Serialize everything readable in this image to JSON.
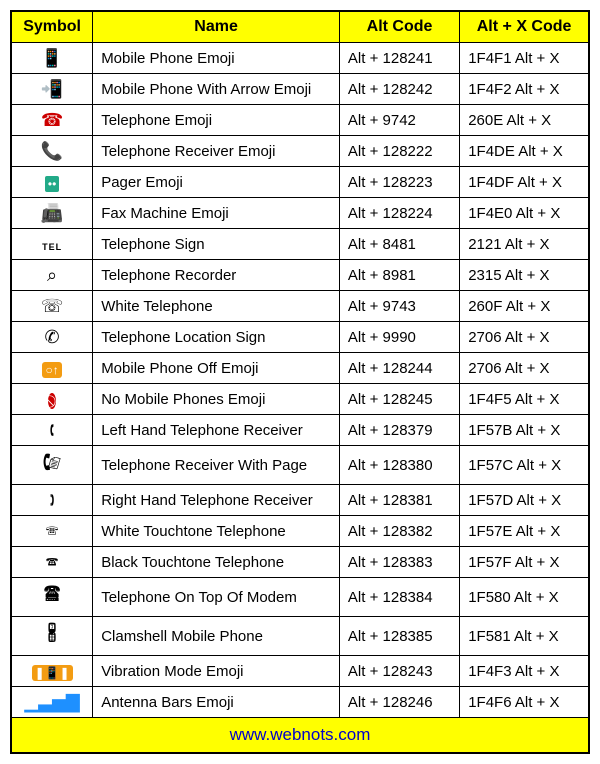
{
  "headers": {
    "symbol": "Symbol",
    "name": "Name",
    "altcode": "Alt Code",
    "altx": "Alt + X Code"
  },
  "rows": [
    {
      "symbol": "📱",
      "name": "Mobile Phone Emoji",
      "altcode": "Alt + 128241",
      "altx": "1F4F1 Alt + X"
    },
    {
      "symbol": "📲",
      "name": "Mobile Phone With Arrow Emoji",
      "altcode": "Alt + 128242",
      "altx": "1F4F2 Alt + X"
    },
    {
      "symbol": "☎",
      "name": "Telephone Emoji",
      "altcode": "Alt + 9742",
      "altx": "260E Alt + X"
    },
    {
      "symbol": "📞",
      "name": "Telephone Receiver Emoji",
      "altcode": "Alt + 128222",
      "altx": "1F4DE Alt + X"
    },
    {
      "symbol": "📟",
      "name": "Pager Emoji",
      "altcode": "Alt + 128223",
      "altx": "1F4DF Alt + X"
    },
    {
      "symbol": "📠",
      "name": "Fax Machine Emoji",
      "altcode": "Alt + 128224",
      "altx": "1F4E0 Alt + X"
    },
    {
      "symbol": "℡",
      "name": "Telephone Sign",
      "altcode": "Alt + 8481",
      "altx": "2121 Alt + X"
    },
    {
      "symbol": "⌕",
      "name": "Telephone Recorder",
      "altcode": "Alt + 8981",
      "altx": "2315 Alt + X"
    },
    {
      "symbol": "☏",
      "name": "White Telephone",
      "altcode": "Alt + 9743",
      "altx": "260F Alt + X"
    },
    {
      "symbol": "✆",
      "name": "Telephone Location Sign",
      "altcode": "Alt + 9990",
      "altx": "2706 Alt + X"
    },
    {
      "symbol": "📴",
      "name": "Mobile Phone Off Emoji",
      "altcode": "Alt + 128244",
      "altx": "2706 Alt + X"
    },
    {
      "symbol": "📵",
      "name": "No Mobile Phones Emoji",
      "altcode": "Alt + 128245",
      "altx": "1F4F5 Alt + X"
    },
    {
      "symbol": "🕻",
      "name": "Left Hand Telephone Receiver",
      "altcode": "Alt + 128379",
      "altx": "1F57B Alt + X"
    },
    {
      "symbol": "🕼",
      "name": "Telephone Receiver With Page",
      "altcode": "Alt + 128380",
      "altx": "1F57C Alt + X"
    },
    {
      "symbol": "🕽",
      "name": "Right Hand Telephone Receiver",
      "altcode": "Alt + 128381",
      "altx": "1F57D Alt + X"
    },
    {
      "symbol": "🕾",
      "name": "White Touchtone Telephone",
      "altcode": "Alt + 128382",
      "altx": "1F57E Alt + X"
    },
    {
      "symbol": "🕿",
      "name": "Black Touchtone Telephone",
      "altcode": "Alt + 128383",
      "altx": "1F57F Alt + X"
    },
    {
      "symbol": "🖀",
      "name": "Telephone On Top Of Modem",
      "altcode": "Alt + 128384",
      "altx": "1F580 Alt + X"
    },
    {
      "symbol": "🖁",
      "name": "Clamshell Mobile Phone",
      "altcode": "Alt + 128385",
      "altx": "1F581 Alt + X"
    },
    {
      "symbol": "📳",
      "name": "Vibration Mode Emoji",
      "altcode": "Alt + 128243",
      "altx": "1F4F3 Alt + X"
    },
    {
      "symbol": "📶",
      "name": "Antenna Bars Emoji",
      "altcode": "Alt + 128246",
      "altx": "1F4F6 Alt + X"
    }
  ],
  "footer": "www.webnots.com"
}
